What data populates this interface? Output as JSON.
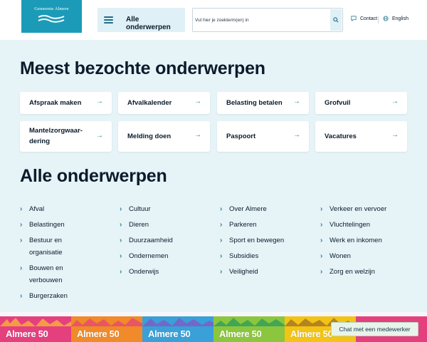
{
  "header": {
    "logo_text": "Gemeente Almere",
    "menu_label": "Alle onderwerpen",
    "search": {
      "placeholder": "Vul hier je zoekterm(en) in",
      "value": ""
    },
    "contact_label": "Contact",
    "language_label": "English"
  },
  "most_visited": {
    "title": "Meest bezochte onderwerpen",
    "cards": [
      {
        "label": "Afspraak maken"
      },
      {
        "label": "Afvalkalender"
      },
      {
        "label": "Belasting betalen"
      },
      {
        "label": "Grofvuil"
      },
      {
        "label": "Mantelzorgwaar-dering"
      },
      {
        "label": "Melding doen"
      },
      {
        "label": "Paspoort"
      },
      {
        "label": "Vacatures"
      }
    ]
  },
  "all_topics": {
    "title": "Alle onderwerpen",
    "columns": [
      [
        "Afval",
        "Belastingen",
        "Bestuur en organisatie",
        "Bouwen en verbouwen",
        "Burgerzaken"
      ],
      [
        "Cultuur",
        "Dieren",
        "Duurzaamheid",
        "Ondernemen",
        "Onderwijs"
      ],
      [
        "Over Almere",
        "Parkeren",
        "Sport en bewegen",
        "Subsidies",
        "Veiligheid"
      ],
      [
        "Verkeer en vervoer",
        "Vluchtelingen",
        "Werk en inkomen",
        "Wonen",
        "Zorg en welzijn"
      ]
    ]
  },
  "banner": {
    "tiles": [
      "Almere 50",
      "Almere 50",
      "Almere 50",
      "Almere 50",
      "Almere 50"
    ]
  },
  "chat_label": "Chat met een medewerker",
  "colors": {
    "brand": "#1b9bb8",
    "background": "#e6f4f8",
    "accent_arrow": "#2f7d95",
    "banner_tiles": [
      "#e4407e",
      "#f08a2a",
      "#3aa0d8",
      "#8cc63f",
      "#f3c316"
    ]
  }
}
